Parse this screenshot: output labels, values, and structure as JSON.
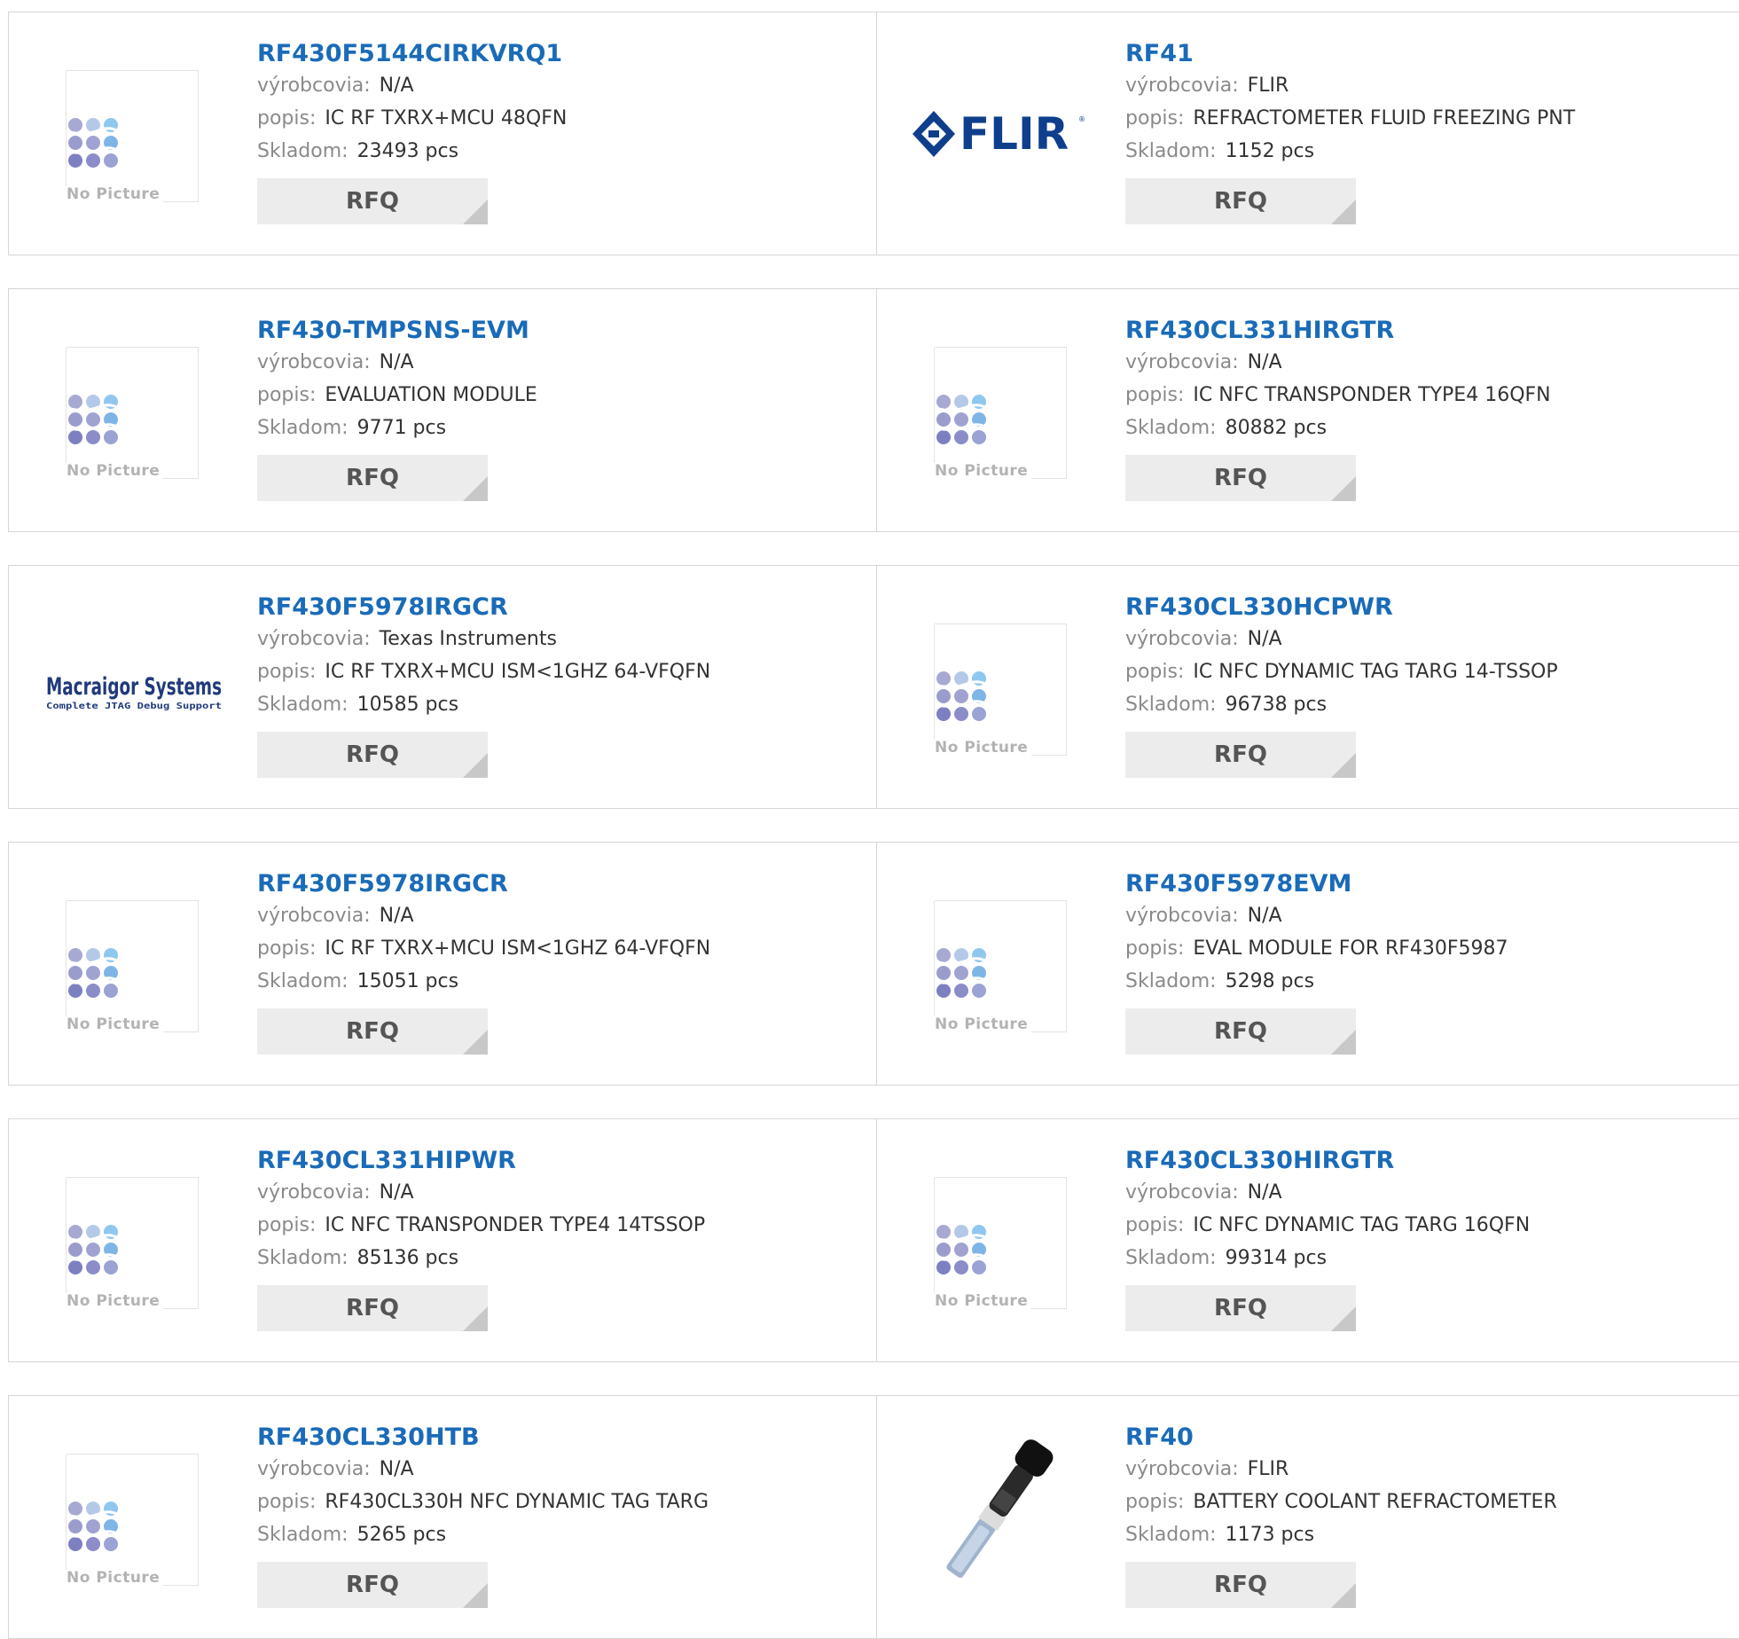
{
  "labels": {
    "manufacturer": "výrobcovia:",
    "description": "popis:",
    "stock": "Skladom:",
    "no_picture": "No Picture",
    "rfq": "RFQ"
  },
  "logos": {
    "flir": "FLIR",
    "macraigor_title": "Macraigor Systems",
    "macraigor_sub": "Complete JTAG Debug Support"
  },
  "products": [
    {
      "part": "RF430F5144CIRKVRQ1",
      "manufacturer": "N/A",
      "description": "IC RF TXRX+MCU 48QFN",
      "stock": "23493 pcs",
      "image": "no-picture"
    },
    {
      "part": "RF41",
      "manufacturer": "FLIR",
      "description": "REFRACTOMETER FLUID FREEZING PNT",
      "stock": "1152 pcs",
      "image": "flir-logo"
    },
    {
      "part": "RF430-TMPSNS-EVM",
      "manufacturer": "N/A",
      "description": "EVALUATION MODULE",
      "stock": "9771 pcs",
      "image": "no-picture"
    },
    {
      "part": "RF430CL331HIRGTR",
      "manufacturer": "N/A",
      "description": "IC NFC TRANSPONDER TYPE4 16QFN",
      "stock": "80882 pcs",
      "image": "no-picture"
    },
    {
      "part": "RF430F5978IRGCR",
      "manufacturer": "Texas Instruments",
      "description": "IC RF TXRX+MCU ISM<1GHZ 64-VFQFN",
      "stock": "10585 pcs",
      "image": "macraigor-logo"
    },
    {
      "part": "RF430CL330HCPWR",
      "manufacturer": "N/A",
      "description": "IC NFC DYNAMIC TAG TARG 14-TSSOP",
      "stock": "96738 pcs",
      "image": "no-picture"
    },
    {
      "part": "RF430F5978IRGCR",
      "manufacturer": "N/A",
      "description": "IC RF TXRX+MCU ISM<1GHZ 64-VFQFN",
      "stock": "15051 pcs",
      "image": "no-picture"
    },
    {
      "part": "RF430F5978EVM",
      "manufacturer": "N/A",
      "description": "EVAL MODULE FOR RF430F5987",
      "stock": "5298 pcs",
      "image": "no-picture"
    },
    {
      "part": "RF430CL331HIPWR",
      "manufacturer": "N/A",
      "description": "IC NFC TRANSPONDER TYPE4 14TSSOP",
      "stock": "85136 pcs",
      "image": "no-picture"
    },
    {
      "part": "RF430CL330HIRGTR",
      "manufacturer": "N/A",
      "description": "IC NFC DYNAMIC TAG TARG 16QFN",
      "stock": "99314 pcs",
      "image": "no-picture"
    },
    {
      "part": "RF430CL330HTB",
      "manufacturer": "N/A",
      "description": "RF430CL330H NFC DYNAMIC TAG TARG",
      "stock": "5265 pcs",
      "image": "no-picture"
    },
    {
      "part": "RF40",
      "manufacturer": "FLIR",
      "description": "BATTERY COOLANT REFRACTOMETER",
      "stock": "1173 pcs",
      "image": "refractometer-photo"
    }
  ]
}
